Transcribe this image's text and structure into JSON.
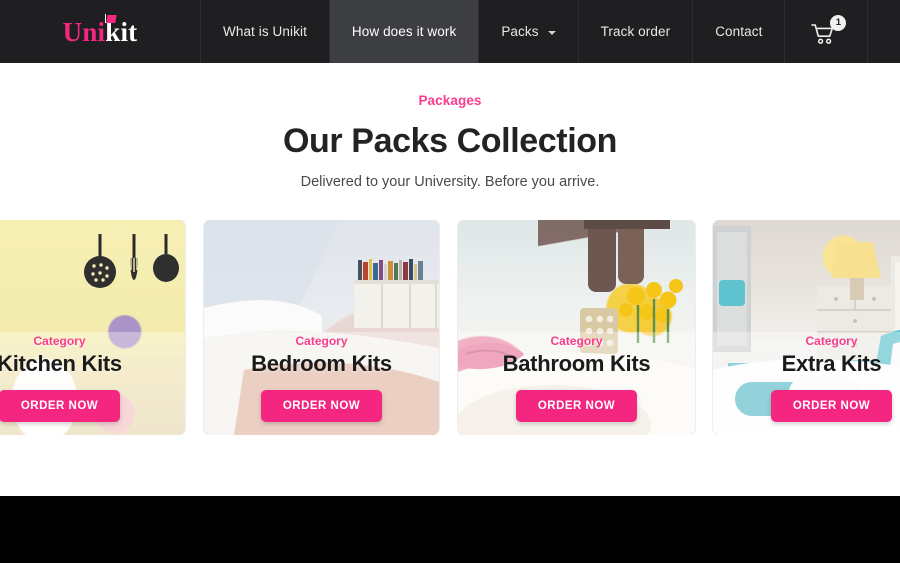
{
  "nav": {
    "logo": {
      "part1": "Uni",
      "part2": "kit",
      "icon": "graduation-cap-icon"
    },
    "items": [
      {
        "label": "What is Unikit",
        "active": false,
        "caret": false
      },
      {
        "label": "How does it work",
        "active": true,
        "caret": false
      },
      {
        "label": "Packs",
        "active": false,
        "caret": true
      },
      {
        "label": "Track order",
        "active": false,
        "caret": false
      },
      {
        "label": "Contact",
        "active": false,
        "caret": false
      }
    ],
    "cart": {
      "icon": "shopping-cart-icon",
      "badge_count": "1"
    }
  },
  "section": {
    "eyebrow": "Packages",
    "title": "Our Packs Collection",
    "subtitle": "Delivered to your University. Before you arrive."
  },
  "cards": [
    {
      "category": "Category",
      "name": "Kitchen Kits",
      "cta": "ORDER NOW"
    },
    {
      "category": "Category",
      "name": "Bedroom Kits",
      "cta": "ORDER NOW"
    },
    {
      "category": "Category",
      "name": "Bathroom Kits",
      "cta": "ORDER NOW"
    },
    {
      "category": "Category",
      "name": "Extra Kits",
      "cta": "ORDER NOW"
    }
  ],
  "colors": {
    "accent_pink": "#f5267f",
    "accent_pink_light": "#fa3c8c",
    "nav_bg": "#1f1f22",
    "nav_active_bg": "#3d3e41",
    "footer_bg": "#000000",
    "title_text": "#232323"
  }
}
